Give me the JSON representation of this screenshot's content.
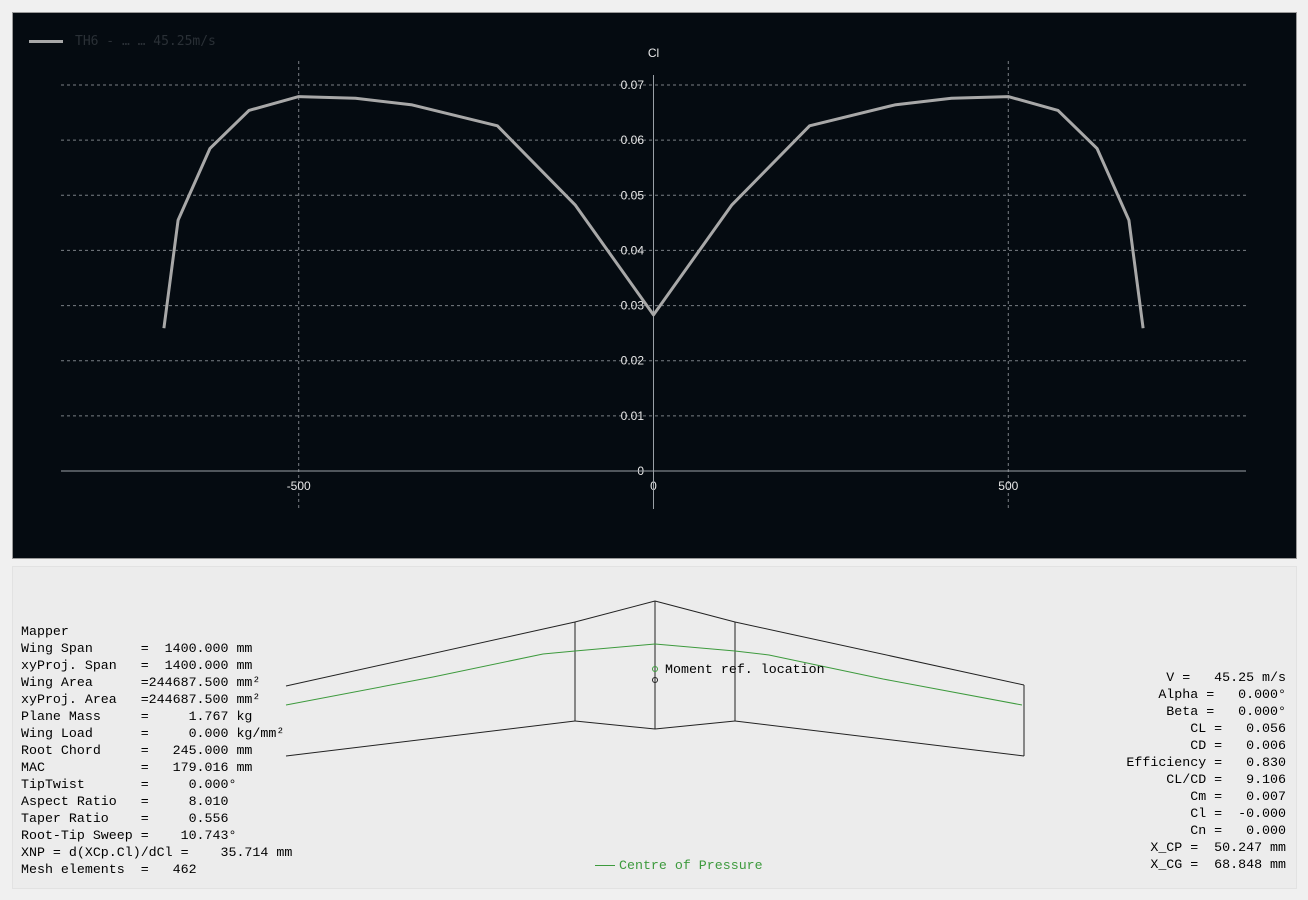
{
  "graph": {
    "legend_label": "TH6 - … … 45.25m/s",
    "legend_color": "#a8a8a8",
    "background": "#050b11",
    "y_axis_label": "Cl",
    "x_ticks": [
      "-500",
      "0",
      "500"
    ],
    "y_ticks": [
      "0",
      "0.01",
      "0.02",
      "0.03",
      "0.04",
      "0.05",
      "0.06",
      "0.07"
    ]
  },
  "chart_data": {
    "type": "line",
    "title": "",
    "xlabel": "",
    "ylabel": "Cl",
    "xlim": [
      -835,
      835
    ],
    "ylim": [
      0,
      0.07
    ],
    "grid": true,
    "series": [
      {
        "name": "TH6 - … … 45.25m/s",
        "color": "#a8a8a8",
        "x": [
          -690,
          -670,
          -625,
          -570,
          -500,
          -420,
          -340,
          -220,
          -110,
          0,
          110,
          220,
          340,
          420,
          500,
          570,
          625,
          670,
          690
        ],
        "y": [
          0.0259,
          0.0455,
          0.0585,
          0.0654,
          0.0679,
          0.0676,
          0.0664,
          0.0626,
          0.0482,
          0.0283,
          0.0482,
          0.0626,
          0.0664,
          0.0676,
          0.0679,
          0.0654,
          0.0585,
          0.0455,
          0.0259
        ]
      }
    ]
  },
  "wing_view": {
    "moment_label": "Moment ref. location",
    "cp_legend_label": "Centre of Pressure",
    "cp_color": "#3d9a3d",
    "outline_color": "#222222"
  },
  "left_info": [
    "Mapper",
    "Wing Span      =  1400.000 mm",
    "xyProj. Span   =  1400.000 mm",
    "Wing Area      =244687.500 mm²",
    "xyProj. Area   =244687.500 mm²",
    "Plane Mass     =     1.767 kg",
    "Wing Load      =     0.000 kg/mm²",
    "Root Chord     =   245.000 mm",
    "MAC            =   179.016 mm",
    "TipTwist       =     0.000°",
    "Aspect Ratio   =     8.010",
    "Taper Ratio    =     0.556",
    "Root-Tip Sweep =    10.743°",
    "XNP = d(XCp.Cl)/dCl =    35.714 mm",
    "Mesh elements  =   462"
  ],
  "right_info": [
    "V =   45.25 m/s",
    "Alpha =   0.000°",
    "Beta =   0.000°",
    "CL =   0.056",
    "CD =   0.006",
    "Efficiency =   0.830",
    "CL/CD =   9.106",
    "Cm =   0.007",
    "Cl =  -0.000",
    "Cn =   0.000",
    "X_CP =  50.247 mm",
    "X_CG =  68.848 mm"
  ]
}
